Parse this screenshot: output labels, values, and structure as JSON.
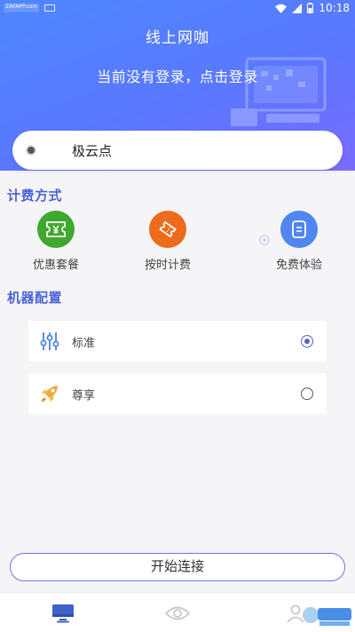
{
  "status_bar": {
    "watermark": "ZAFAPP.com",
    "time": "10:18"
  },
  "header": {
    "title": "线上网咖",
    "login_prompt": "当前没有登录，点击登录",
    "gradient_colors": [
      "#4d86ff",
      "#7a6bff"
    ]
  },
  "location": {
    "name": "极云点"
  },
  "billing": {
    "title": "计费方式",
    "options": [
      {
        "label": "优惠套餐",
        "icon": "ticket-yen-icon",
        "color": "#3fa82f"
      },
      {
        "label": "按时计费",
        "icon": "ticket-icon",
        "color": "#ee6a1c"
      },
      {
        "label": "免费体验",
        "icon": "chat-card-icon",
        "color": "#4f86f0"
      }
    ]
  },
  "machine": {
    "title": "机器配置",
    "options": [
      {
        "label": "标准",
        "icon": "sliders-icon",
        "selected": true
      },
      {
        "label": "尊享",
        "icon": "rocket-icon",
        "selected": false
      }
    ]
  },
  "actions": {
    "start_label": "开始连接"
  },
  "nav": {
    "items": [
      {
        "icon": "desktop-icon",
        "active": true
      },
      {
        "icon": "eye-icon",
        "active": false
      },
      {
        "icon": "profile-icon",
        "active": false
      }
    ]
  },
  "accent_color": "#5560cc"
}
